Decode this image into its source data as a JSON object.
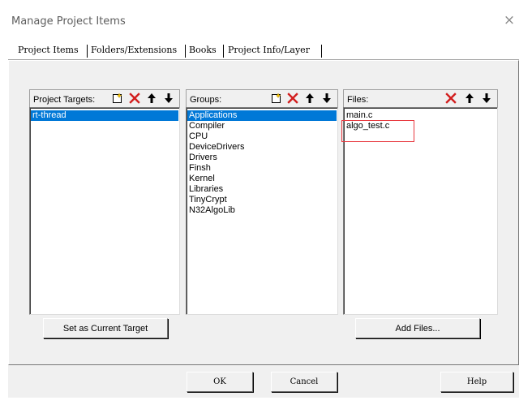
{
  "window": {
    "title": "Manage Project Items",
    "close_glyph": "×"
  },
  "tabs": [
    {
      "label": "Project Items"
    },
    {
      "label": "Folders/Extensions"
    },
    {
      "label": "Books"
    },
    {
      "label": "Project Info/Layer"
    }
  ],
  "targets": {
    "title": "Project Targets:",
    "items": [
      "rt-thread"
    ],
    "selected": "rt-thread",
    "button": "Set as Current Target"
  },
  "groups": {
    "title": "Groups:",
    "items": [
      "Applications",
      "Compiler",
      "CPU",
      "DeviceDrivers",
      "Drivers",
      "Finsh",
      "Kernel",
      "Libraries",
      "TinyCrypt",
      "N32AlgoLib"
    ],
    "selected": "Applications"
  },
  "files": {
    "title": "Files:",
    "items": [
      "main.c",
      "algo_test.c"
    ],
    "button": "Add Files...",
    "highlight_color": "#e8393f"
  },
  "footer": {
    "ok": "OK",
    "cancel": "Cancel",
    "help": "Help"
  },
  "icons": {
    "new": "new-item-icon",
    "delete": "delete-x-icon",
    "up": "move-up-arrow-icon",
    "down": "move-down-arrow-icon"
  },
  "colors": {
    "selection": "#0078d7",
    "delete_red": "#d21e1e"
  }
}
